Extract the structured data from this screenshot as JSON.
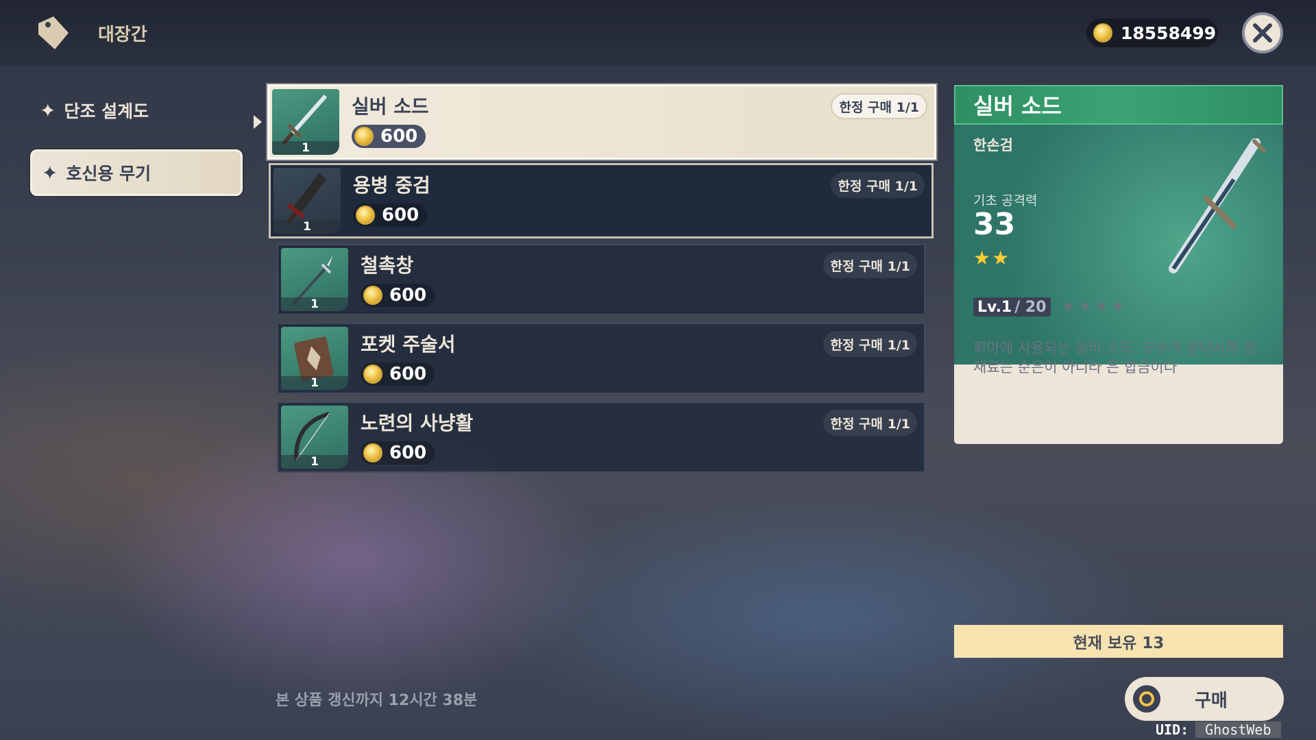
{
  "header": {
    "title": "대장간",
    "currency_amount": "18558499"
  },
  "nav": {
    "items": [
      {
        "label": "단조 설계도"
      },
      {
        "label": "호신용 무기"
      }
    ]
  },
  "items": [
    {
      "name": "실버 소드",
      "price": "600",
      "limit": "한정 구매 1/1",
      "qty": "1",
      "icon": "sword-icon"
    },
    {
      "name": "용병 중검",
      "price": "600",
      "limit": "한정 구매 1/1",
      "qty": "1",
      "icon": "claymore-icon"
    },
    {
      "name": "철촉창",
      "price": "600",
      "limit": "한정 구매 1/1",
      "qty": "1",
      "icon": "polearm-icon"
    },
    {
      "name": "포켓 주술서",
      "price": "600",
      "limit": "한정 구매 1/1",
      "qty": "1",
      "icon": "catalyst-icon"
    },
    {
      "name": "노련의 사냥활",
      "price": "600",
      "limit": "한정 구매 1/1",
      "qty": "1",
      "icon": "bow-icon"
    }
  ],
  "detail": {
    "name": "실버 소드",
    "weapon_type": "한손검",
    "stat_label": "기초 공격력",
    "stat_value": "33",
    "rarity": "★★",
    "level": "Lv.1",
    "level_cap": "/ 20",
    "refinement": "✦✦✦✦",
    "description": "퇴마에 사용되는 실버 소드. 모두가 알다시피 원재료는 순은이 아니라 은 합금이다"
  },
  "owned": "현재 보유 13",
  "buy_label": "구매",
  "refresh_text": "본 상품 갱신까지 12시간 38분",
  "uid": {
    "label": "UID:",
    "value": "GhostWeb"
  },
  "colors": {
    "accent_green": "#3aa374",
    "panel_cream": "#ece5d8",
    "coin_gold": "#f0c64a",
    "owned_bar": "#f6e3b0"
  }
}
